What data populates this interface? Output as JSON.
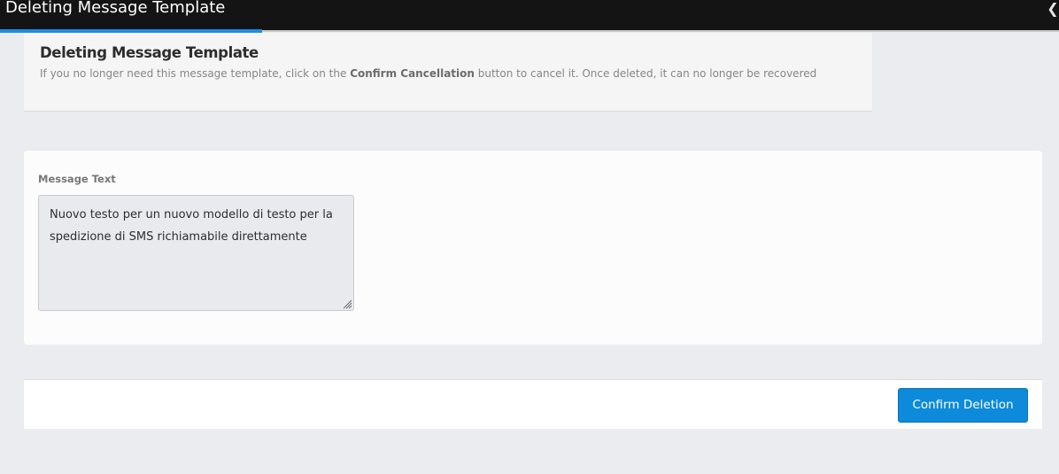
{
  "window": {
    "title": "Deleting Message Template",
    "collapse_icon": "chevron-left-icon"
  },
  "header": {
    "title": "Deleting Message Template",
    "desc_before": "If you no longer need this message template, click on the ",
    "desc_bold": "Confirm Cancellation",
    "desc_after": " button to cancel it. Once deleted, it can no longer be recovered"
  },
  "form": {
    "message_label": "Message Text",
    "message_value": "Nuovo testo per un nuovo modello di testo per la spedizione di SMS richiamabile direttamente"
  },
  "footer": {
    "confirm_label": "Confirm Deletion"
  },
  "colors": {
    "topbar": "#141414",
    "accent": "#1a8fe0",
    "button": "#0d8ad9",
    "background": "#ebecef"
  }
}
